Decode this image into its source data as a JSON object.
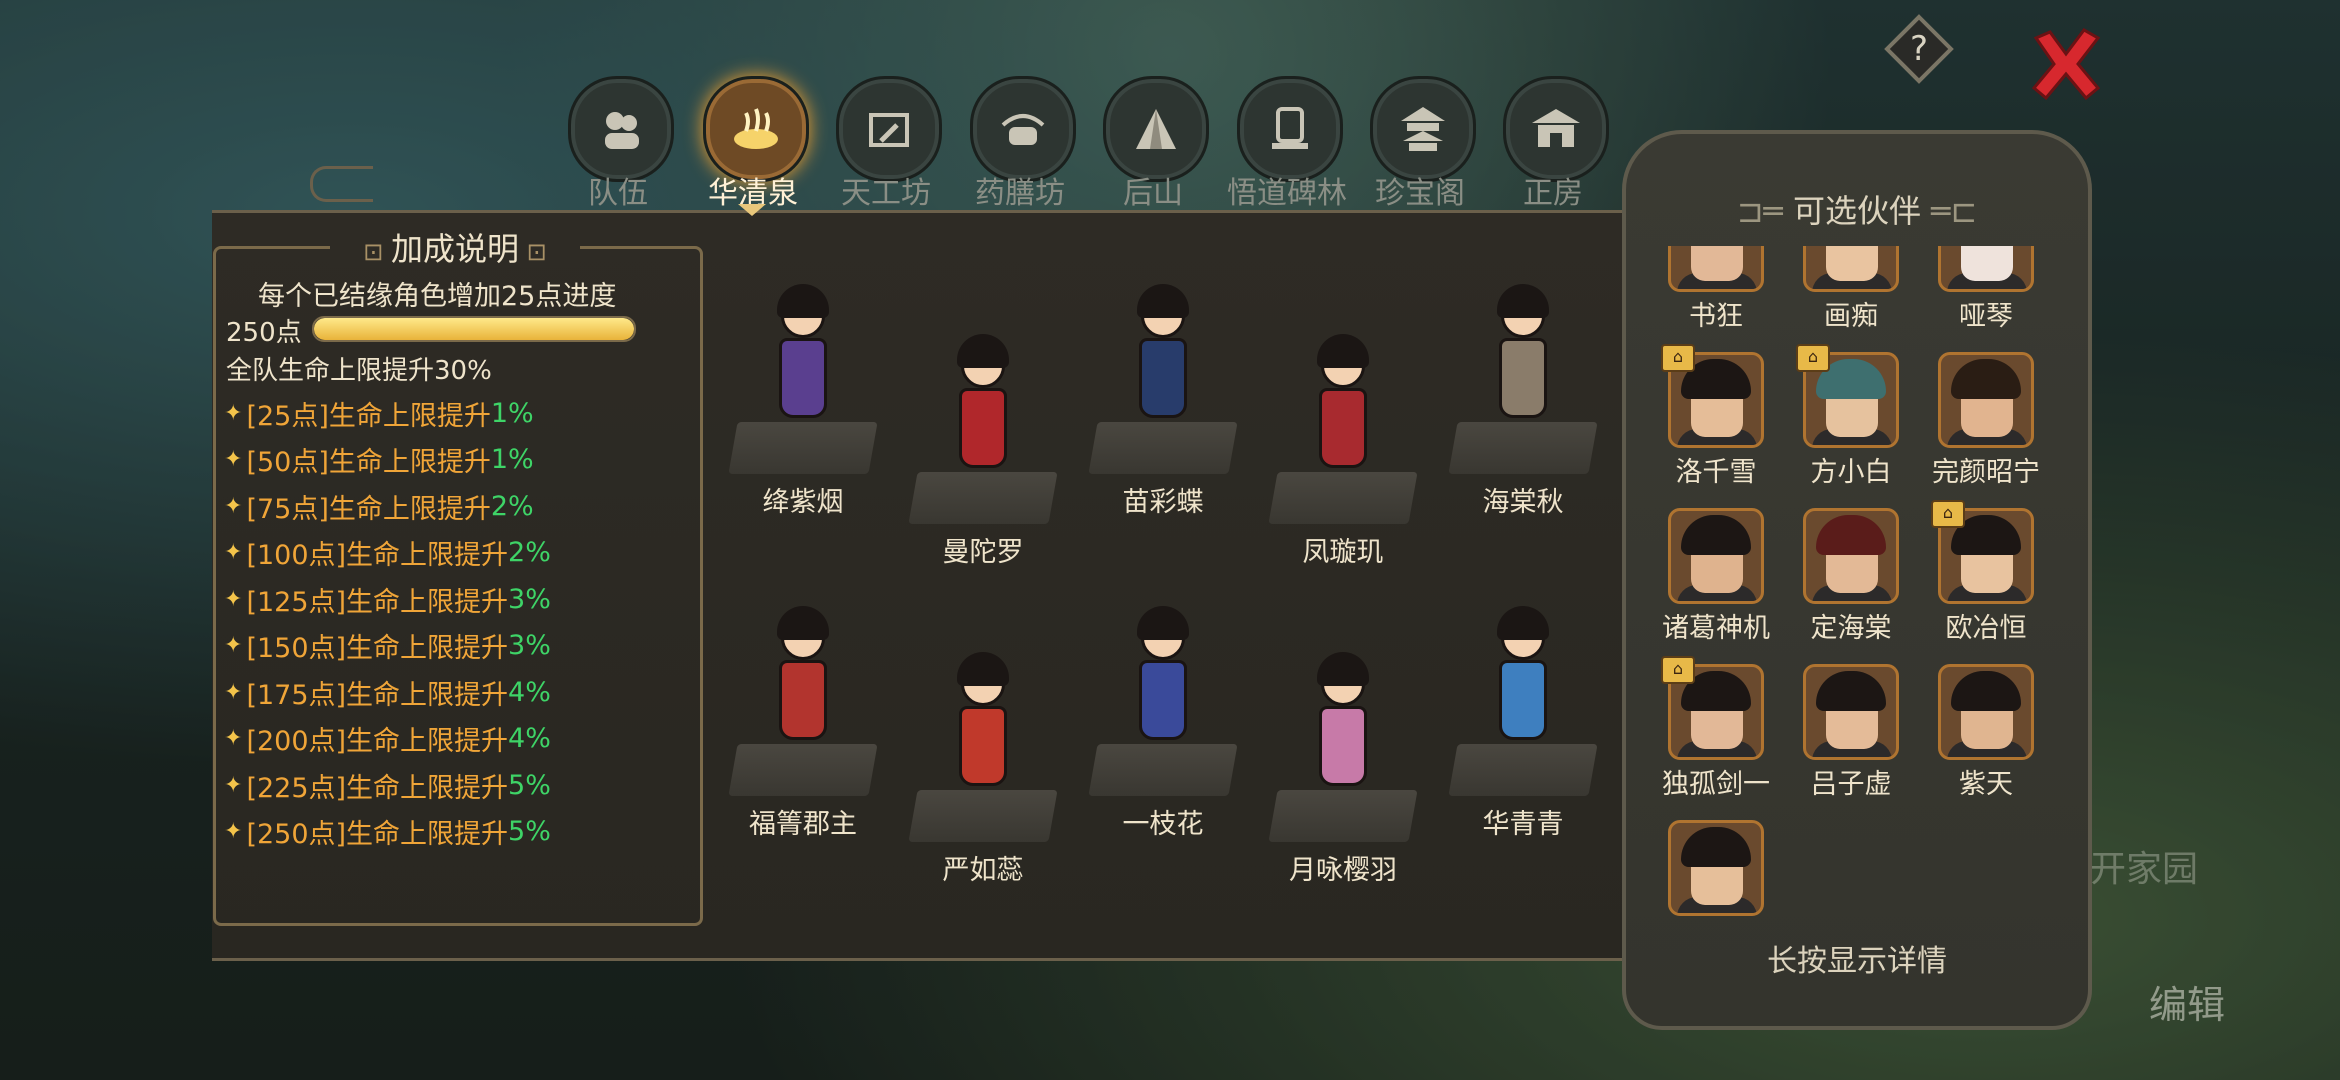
{
  "colors": {
    "accent": "#e9b33a",
    "pct_green": "#3ed467",
    "point_orange": "#f0a538",
    "close_red": "#d7282e"
  },
  "tabs": [
    {
      "label": "队伍",
      "icon": "team-icon",
      "active": false
    },
    {
      "label": "华清泉",
      "icon": "hot-spring-icon",
      "active": true
    },
    {
      "label": "天工坊",
      "icon": "workshop-icon",
      "active": false
    },
    {
      "label": "药膳坊",
      "icon": "kitchen-icon",
      "active": false
    },
    {
      "label": "后山",
      "icon": "mountain-icon",
      "active": false
    },
    {
      "label": "悟道碑林",
      "icon": "stele-icon",
      "active": false
    },
    {
      "label": "珍宝阁",
      "icon": "pavilion-icon",
      "active": false
    },
    {
      "label": "正房",
      "icon": "house-icon",
      "active": false
    }
  ],
  "bonus": {
    "title": "加成说明",
    "per_character": "每个已结缘角色增加25点进度",
    "points": "250点",
    "progress_fraction": 1.0,
    "team_bonus": "全队生命上限提升30%",
    "rows": [
      {
        "points": "[25点]",
        "text": "生命上限提升",
        "pct": "1%"
      },
      {
        "points": "[50点]",
        "text": "生命上限提升",
        "pct": "1%"
      },
      {
        "points": "[75点]",
        "text": "生命上限提升",
        "pct": "2%"
      },
      {
        "points": "[100点]",
        "text": "生命上限提升",
        "pct": "2%"
      },
      {
        "points": "[125点]",
        "text": "生命上限提升",
        "pct": "3%"
      },
      {
        "points": "[150点]",
        "text": "生命上限提升",
        "pct": "3%"
      },
      {
        "points": "[175点]",
        "text": "生命上限提升",
        "pct": "4%"
      },
      {
        "points": "[200点]",
        "text": "生命上限提升",
        "pct": "4%"
      },
      {
        "points": "[225点]",
        "text": "生命上限提升",
        "pct": "5%"
      },
      {
        "points": "[250点]",
        "text": "生命上限提升",
        "pct": "5%"
      }
    ]
  },
  "characters": [
    {
      "name": "绛紫烟",
      "outfit": "#5a3f8f"
    },
    {
      "name": "曼陀罗",
      "outfit": "#b0272b"
    },
    {
      "name": "苗彩蝶",
      "outfit": "#283c6b"
    },
    {
      "name": "凤璇玑",
      "outfit": "#a82a2f"
    },
    {
      "name": "海棠秋",
      "outfit": "#8a7c6a"
    },
    {
      "name": "福箐郡主",
      "outfit": "#b2342e"
    },
    {
      "name": "严如蕊",
      "outfit": "#c0392b"
    },
    {
      "name": "一枝花",
      "outfit": "#3a4a9a"
    },
    {
      "name": "月咏樱羽",
      "outfit": "#c77aa8"
    },
    {
      "name": "华青青",
      "outfit": "#3e7fbf"
    }
  ],
  "partners": {
    "title": "可选伙伴",
    "hint": "长按显示详情",
    "items": [
      {
        "name": "书狂",
        "locked": true
      },
      {
        "name": "画痴",
        "locked": true
      },
      {
        "name": "哑琴",
        "locked": true
      },
      {
        "name": "洛千雪",
        "locked": true
      },
      {
        "name": "方小白",
        "locked": true
      },
      {
        "name": "完颜昭宁",
        "locked": false
      },
      {
        "name": "诸葛神机",
        "locked": false
      },
      {
        "name": "定海棠",
        "locked": false
      },
      {
        "name": "欧冶恒",
        "locked": true
      },
      {
        "name": "独孤剑一",
        "locked": true
      },
      {
        "name": "吕子虚",
        "locked": false
      },
      {
        "name": "紫天",
        "locked": false
      },
      {
        "name": "",
        "locked": false
      }
    ]
  },
  "background": {
    "faded_text": "开家园",
    "edit": "编辑"
  }
}
